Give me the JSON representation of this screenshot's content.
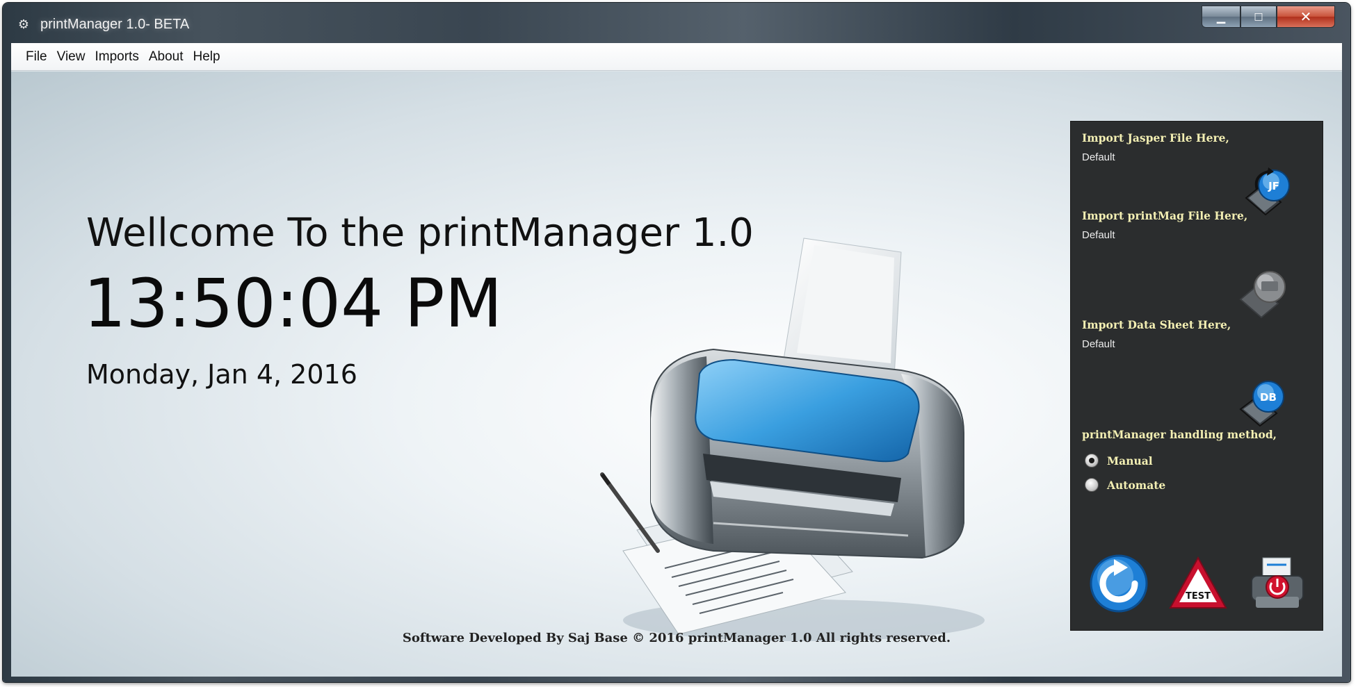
{
  "window": {
    "title": "printManager 1.0- BETA",
    "controls": {
      "minimize": "▁",
      "maximize": "□",
      "close": "✕"
    }
  },
  "menu": [
    {
      "label": "File"
    },
    {
      "label": "View"
    },
    {
      "label": "Imports"
    },
    {
      "label": "About"
    },
    {
      "label": "Help"
    }
  ],
  "main": {
    "welcome": "Wellcome To the printManager 1.0",
    "time": "13:50:04 PM",
    "date": "Monday, Jan 4, 2016",
    "footer": "Software Developed By Saj Base © 2016 printManager 1.0 All rights reserved."
  },
  "panel": {
    "jasper": {
      "heading": "Import Jasper File Here,",
      "value": "Default",
      "icon": "jasper-import-icon",
      "badge": "JF"
    },
    "printmag": {
      "heading": "Import printMag File Here,",
      "value": "Default",
      "icon": "printmag-import-icon"
    },
    "datasheet": {
      "heading": "Import Data Sheet Here,",
      "value": "Default",
      "icon": "datasheet-import-icon",
      "badge": "DB"
    },
    "method": {
      "heading": "printManager handling method,",
      "options": [
        {
          "label": "Manual",
          "checked": true
        },
        {
          "label": "Automate",
          "checked": false
        }
      ]
    },
    "actions": {
      "refresh": "refresh-icon",
      "test": {
        "icon": "test-warning-icon",
        "label": "TEST"
      },
      "print_power": "printer-power-icon"
    }
  },
  "colors": {
    "panel_bg": "#2b2d2e",
    "panel_heading": "#f3efb3",
    "printer_blue": "#3a9fe0",
    "refresh_blue": "#1e7fd6",
    "test_red": "#c8102e"
  }
}
